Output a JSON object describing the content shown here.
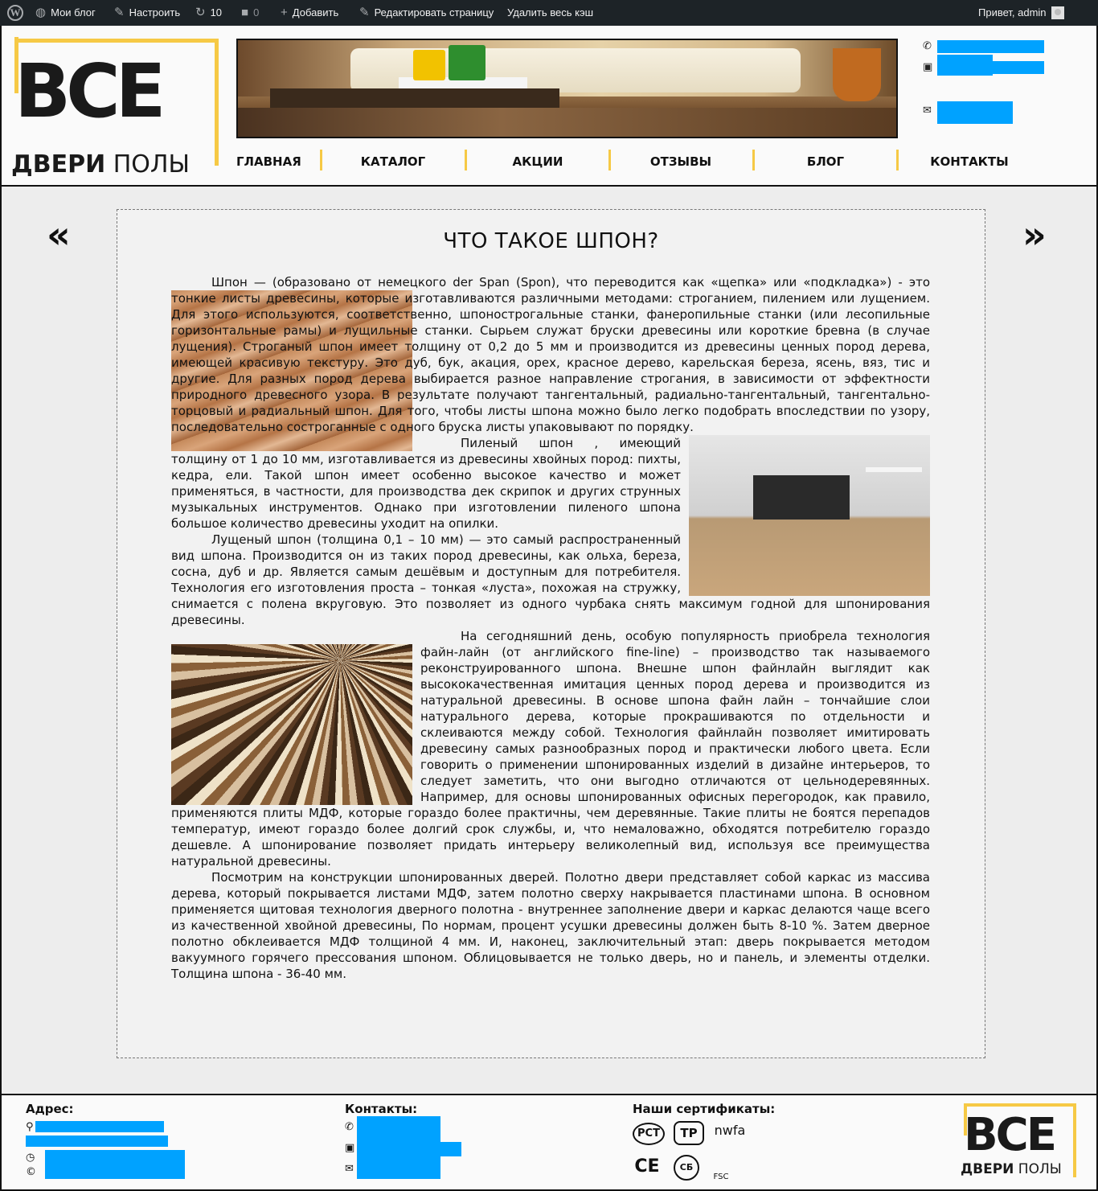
{
  "adminbar": {
    "site": "Мои блог",
    "customize": "Настроить",
    "updates": "10",
    "comments": "0",
    "add": "Добавить",
    "edit_page": "Редактировать страницу",
    "clear_cache": "Удалить весь кэш",
    "greeting": "Привет, admin"
  },
  "logo": {
    "big": "ВСЕ",
    "small_bold": "ДВЕРИ",
    "small": " ПОЛЫ"
  },
  "nav": [
    {
      "label": "ГЛАВНАЯ"
    },
    {
      "label": "КАТАЛОГ"
    },
    {
      "label": "АКЦИИ"
    },
    {
      "label": "ОТЗЫВЫ"
    },
    {
      "label": "БЛОГ"
    },
    {
      "label": "КОНТАКТЫ"
    }
  ],
  "article": {
    "title": "ЧТО ТАКОЕ ШПОН?",
    "paragraphs": [
      "Шпон — (образовано от немецкого der Span (Spon), что переводится как «щепка» или «подкладка») - это тонкие листы древесины, которые изготавливаются различными методами: строганием, пилением или лущением. Для этого используются, соответственно, шпонострогальные станки, фанеропильные станки (или лесопильные горизонтальные рамы) и лущильные станки. Сырьем служат бруски древесины или короткие бревна (в случае лущения). Строганый шпон имеет толщину от 0,2 до 5 мм и производится из древесины ценных пород дерева, имеющей красивую текстуру. Это дуб, бук, акация, орех, красное дерево, карельская береза, ясень, вяз, тис и другие. Для разных пород дерева выбирается разное направление строгания, в зависимости от эффектности природного древесного узора. В результате получают тангентальный, радиально-тангентальный, тангентально-торцовый и радиальный шпон. Для того, чтобы листы шпона можно было легко подобрать впоследствии по узору, последовательно состроганные с одного бруска листы упаковывают по порядку.",
      "Пиленый шпон , имеющий толщину от 1 до 10 мм, изготавливается из древесины хвойных пород: пихты, кедра, ели. Такой шпон имеет особенно высокое качество и может применяться, в частности, для производства дек скрипок и других струнных музыкальных инструментов. Однако при изготовлении пиленого шпона большое количество древесины уходит на опилки.",
      "Лущеный шпон (толщина 0,1 – 10 мм) — это самый распространенный вид шпона. Производится он из таких пород древесины, как ольха, береза, сосна, дуб и др. Является самым дешёвым и доступным для потребителя. Технология его изготовления проста – тонкая «луста», похожая на стружку, снимается с полена вкруговую. Это позволяет из одного чурбака снять максимум годной для шпонирования древесины.",
      "На сегодняшний день, особую популярность приобрела технология файн-лайн (от английского fine-line) – производство так называемого реконструированного шпона. Внешне шпон файнлайн выглядит как высококачественная имитация ценных пород дерева и производится из натуральной древесины. В основе шпона файн лайн – тончайшие слои натурального дерева, которые прокрашиваются по отдельности и склеиваются между собой. Технология файнлайн позволяет имитировать древесину самых разнообразных пород и практически любого цвета. Если говорить о применении шпонированных изделий в дизайне интерьеров, то следует заметить, что они выгодно отличаются от цельнодеревянных. Например, для основы шпонированных офисных перегородок, как правило, применяются плиты МДФ, которые гораздо более практичны, чем деревянные. Такие плиты не боятся перепадов температур, имеют гораздо более долгий срок службы, и, что немаловажно, обходятся потребителю гораздо дешевле. А шпонирование позволяет придать интерьеру великолепный вид, используя все преимущества натуральной древесины.",
      "Посмотрим на конструкции шпонированных дверей. Полотно двери представляет собой каркас из массива дерева, который покрывается листами МДФ, затем полотно сверху накрывается пластинами шпона. В основном применяется щитовая технология дверного полотна - внутреннее заполнение двери и каркас делаются чаще всего из качественной хвойной древесины, По нормам, процент усушки древесины должен быть 8-10 %. Затем дверное полотно обклеивается МДФ толщиной 4 мм. И, наконец, заключительный этап: дверь покрывается методом вакуумного горячего прессования шпоном. Облицовывается не только дверь, но и панель, и элементы отделки. Толщина шпона - 36-40 мм."
    ]
  },
  "footer": {
    "address_title": "Адрес:",
    "contacts_title": "Контакты:",
    "certs_title": "Наши сертификаты:",
    "certs": [
      "РСТ",
      "ТР",
      "nwfa",
      "CE",
      "СБ",
      "FSC"
    ]
  },
  "colors": {
    "accent": "#f6c945",
    "redaction": "#00a2ff",
    "adminbar": "#1d2327"
  }
}
